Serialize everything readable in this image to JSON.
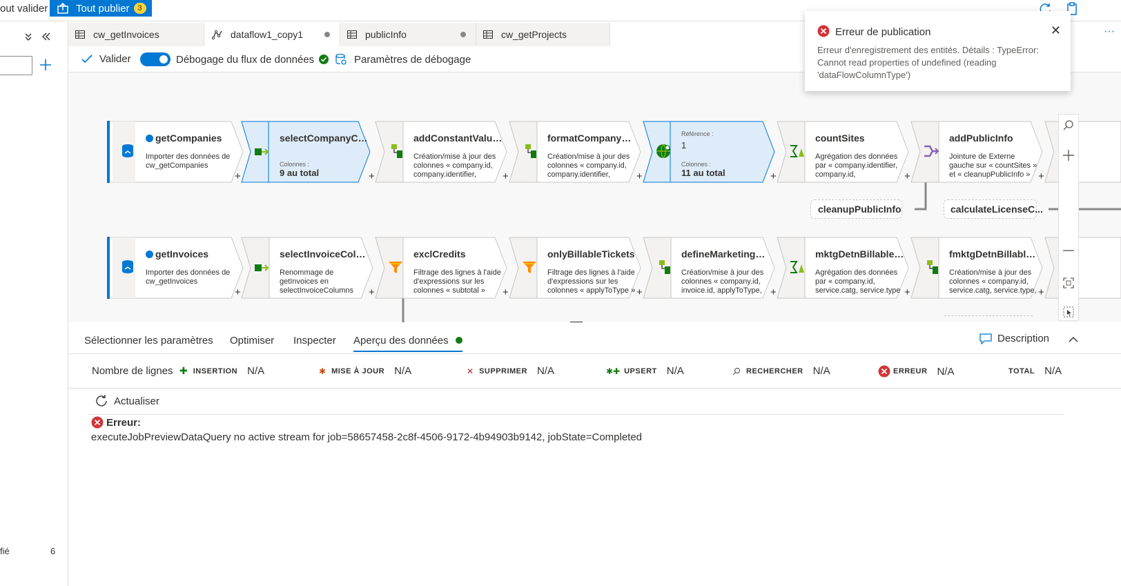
{
  "topbar": {
    "validate_all": "out valider",
    "publish_label": "Tout publier",
    "publish_count": "3"
  },
  "sidebar": {
    "footer_label": "fié",
    "footer_count": "6"
  },
  "tabs": [
    {
      "label": "cw_getInvoices",
      "icon": "table-icon",
      "modified": false
    },
    {
      "label": "dataflow1_copy1",
      "icon": "dataflow-icon",
      "modified": true
    },
    {
      "label": "publicInfo",
      "icon": "table-icon",
      "modified": true
    },
    {
      "label": "cw_getProjects",
      "icon": "table-icon",
      "modified": false
    }
  ],
  "toolbar": {
    "validate": "Valider",
    "debug_label": "Débogage du flux de données",
    "debug_enabled": true,
    "debug_settings": "Paramètres de débogage"
  },
  "canvas": {
    "row1": [
      {
        "title": "getCompanies",
        "desc": "Importer des données de cw_getCompanies",
        "type": "source"
      },
      {
        "title": "selectCompanyCol...",
        "col_label": "Colonnes :",
        "col_value": "9 au total",
        "type": "select",
        "selected": true
      },
      {
        "title": "addConstantValue...",
        "desc": "Création/mise à jour des colonnes « company.id, company.identifier, mainContact.id",
        "type": "derive"
      },
      {
        "title": "formatCompanySit...",
        "desc": "Création/mise à jour des colonnes « company.id, company.identifier, mainContact.id",
        "type": "derive"
      },
      {
        "ref_label": "Référence :",
        "ref_value": "1",
        "col_label": "Colonnes :",
        "col_value": "11 au total",
        "type": "join",
        "selected": true
      },
      {
        "title": "countSites",
        "desc": "Agrégation des données par « company.identifier, company.id, mainContact.id",
        "type": "aggregate"
      },
      {
        "title": "addPublicInfo",
        "desc": "Jointure de Externe gauche sur « countSites » et « cleanupPublicInfo »",
        "type": "join"
      }
    ],
    "row2": [
      {
        "title": "getInvoices",
        "desc": "Importer des données de cw_getInvoices",
        "type": "source"
      },
      {
        "title": "selectInvoiceColum...",
        "desc": "Renommage de getInvoices en selectInvoiceColumns avec des colonnes",
        "type": "select"
      },
      {
        "title": "exclCredits",
        "desc": "Filtrage des lignes à l'aide d'expressions sur les colonnes « subtotal »",
        "type": "filter"
      },
      {
        "title": "onlyBillableTickets",
        "desc": "Filtrage des lignes à l'aide d'expressions sur les colonnes « applyToType »",
        "type": "filter"
      },
      {
        "title": "defineMarketingDe...",
        "desc": "Création/mise à jour des colonnes « company.id, invoice.id, applyToType, applyToId, status.name",
        "type": "derive"
      },
      {
        "title": "mktgDetnBillableS...",
        "desc": "Agrégation des données par « company.id, service.catg, service.type » générant",
        "type": "aggregate"
      },
      {
        "title": "fmktgDetnBillableS...",
        "desc": "Création/mise à jour des colonnes « company.id, service.catg, service.type, date »",
        "type": "derive"
      }
    ],
    "branches": [
      {
        "title": "cleanupPublicInfo",
        "type": "select"
      },
      {
        "title": "calculateLicenseC...",
        "type": "aggregate"
      }
    ]
  },
  "notification": {
    "title": "Erreur de publication",
    "message": "Erreur d'enregistrement des entités. Détails : TypeError: Cannot read properties of undefined (reading 'dataFlowColumnType')"
  },
  "bottom_tabs": {
    "items": [
      "Sélectionner les paramètres",
      "Optimiser",
      "Inspecter",
      "Aperçu des données"
    ],
    "active": "Aperçu des données",
    "description": "Description"
  },
  "row_counts": {
    "label": "Nombre de lignes",
    "items": [
      {
        "caption": "INSERTION",
        "value": "N/A",
        "color": "#107c10"
      },
      {
        "caption": "MISE À JOUR",
        "value": "N/A",
        "color": "#ca5010"
      },
      {
        "caption": "SUPPRIMER",
        "value": "N/A",
        "color": "#a4262c"
      },
      {
        "caption": "UPSERT",
        "value": "N/A",
        "color": "#107c10"
      },
      {
        "caption": "RECHERCHER",
        "value": "N/A",
        "color": "#605e5c"
      },
      {
        "caption": "ERREUR",
        "value": "N/A",
        "color": "#d13438"
      },
      {
        "caption": "TOTAL",
        "value": "N/A",
        "color": "#323130"
      }
    ]
  },
  "preview": {
    "refresh": "Actualiser",
    "error_title": "Erreur:",
    "error_message": "executeJobPreviewDataQuery no active stream for job=58657458-2c8f-4506-9172-4b94903b9142, jobState=Completed"
  },
  "colors": {
    "accent": "#0078d4",
    "error": "#d13438",
    "success": "#107c10",
    "selected_fill": "#deecf9"
  }
}
